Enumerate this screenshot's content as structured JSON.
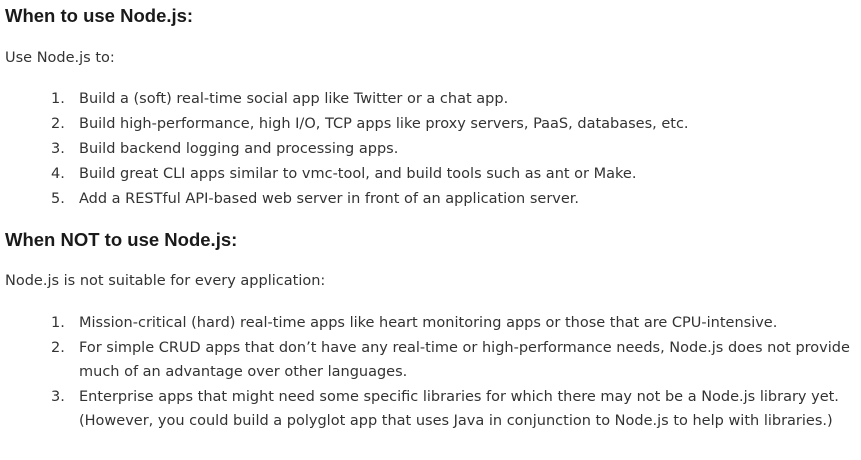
{
  "section1": {
    "heading": "When to use Node.js:",
    "intro": "Use Node.js to:",
    "items": [
      {
        "num": "1.",
        "text": "Build a (soft) real-time social app like Twitter or a chat app."
      },
      {
        "num": "2.",
        "text": "Build high-performance, high I/O, TCP apps like proxy servers, PaaS, databases, etc."
      },
      {
        "num": "3.",
        "text": "Build backend logging and processing apps."
      },
      {
        "num": "4.",
        "text": "Build great CLI apps similar to vmc-tool, and build tools such as ant or Make."
      },
      {
        "num": "5.",
        "text": "Add a RESTful API-based web server in front of an application server."
      }
    ]
  },
  "section2": {
    "heading": "When NOT to use Node.js:",
    "intro": "Node.js is not suitable for every application:",
    "items": [
      {
        "num": "1.",
        "text": "Mission-critical (hard) real-time apps like heart monitoring apps or those that are CPU-intensive."
      },
      {
        "num": "2.",
        "text": "For simple CRUD apps that don’t have any real-time or high-performance needs, Node.js does not provide much of an advantage over other languages."
      },
      {
        "num": "3.",
        "text": "Enterprise apps that might need some specific libraries for which there may not be a Node.js library yet. (However, you could build a polyglot app that uses Java in conjunction to Node.js to help with libraries.)"
      }
    ]
  }
}
